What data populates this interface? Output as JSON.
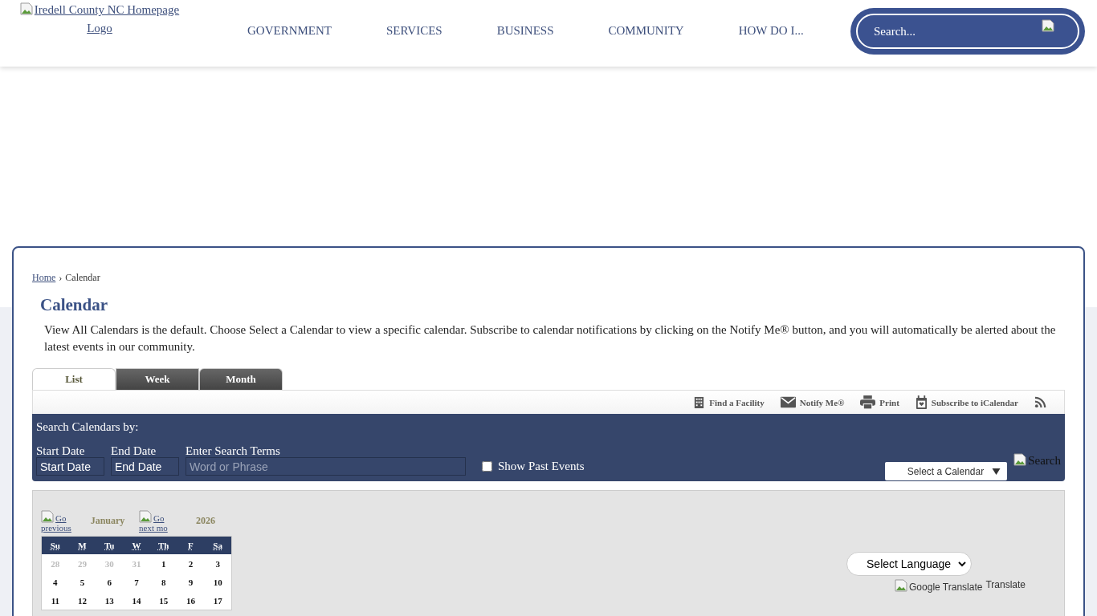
{
  "header": {
    "logo_alt": "Iredell County NC Homepage Logo",
    "nav": [
      {
        "label": "GOVERNMENT"
      },
      {
        "label": "SERVICES"
      },
      {
        "label": "BUSINESS"
      },
      {
        "label": "COMMUNITY"
      },
      {
        "label": "HOW DO I..."
      }
    ],
    "search": {
      "placeholder": "Search..."
    }
  },
  "breadcrumb": {
    "items": [
      {
        "label": "Home",
        "link": true
      },
      {
        "label": "Calendar",
        "link": false
      }
    ],
    "separator": "›"
  },
  "title": "Calendar",
  "intro": "View All Calendars is the default. Choose Select a Calendar to view a specific calendar. Subscribe to calendar notifications by clicking on the Notify Me® button, and you will automatically be alerted about the latest events in our community.",
  "tabs": [
    {
      "label": "List",
      "selected": true
    },
    {
      "label": "Week",
      "selected": false
    },
    {
      "label": "Month",
      "selected": false
    }
  ],
  "toolbar": [
    {
      "kind": "facility",
      "label": "Find a Facility"
    },
    {
      "kind": "notify",
      "label": "Notify Me®"
    },
    {
      "kind": "print",
      "label": "Print"
    },
    {
      "kind": "ical",
      "label": "Subscribe to iCalendar"
    },
    {
      "kind": "rss"
    }
  ],
  "search_panel": {
    "heading": "Search Calendars by:",
    "start_label": "Start Date",
    "start_placeholder": "Start Date",
    "end_label": "End Date",
    "end_placeholder": "End Date",
    "terms_label": "Enter Search Terms",
    "terms_placeholder": "Word or Phrase",
    "past_events": {
      "label": "Show Past Events",
      "checked": false
    },
    "calendar_select": "Select a Calendar",
    "search_alt": "Search"
  },
  "mini_calendar": {
    "prev_link": "Go previous",
    "month": "January",
    "next_link": "Go next mo",
    "year": "2026",
    "weekdays": [
      "Su",
      "M",
      "Tu",
      "W",
      "Th",
      "F",
      "Sa"
    ],
    "weeks": [
      [
        {
          "day": "28",
          "muted": true
        },
        {
          "day": "29",
          "muted": true
        },
        {
          "day": "30",
          "muted": true
        },
        {
          "day": "31",
          "muted": true
        },
        {
          "day": "1",
          "muted": false
        },
        {
          "day": "2",
          "muted": false
        },
        {
          "day": "3",
          "muted": false
        }
      ],
      [
        {
          "day": "4",
          "muted": false
        },
        {
          "day": "5",
          "muted": false
        },
        {
          "day": "6",
          "muted": false
        },
        {
          "day": "7",
          "muted": false
        },
        {
          "day": "8",
          "muted": false
        },
        {
          "day": "9",
          "muted": false
        },
        {
          "day": "10",
          "muted": false
        }
      ],
      [
        {
          "day": "11",
          "muted": false
        },
        {
          "day": "12",
          "muted": false
        },
        {
          "day": "13",
          "muted": false
        },
        {
          "day": "14",
          "muted": false
        },
        {
          "day": "15",
          "muted": false
        },
        {
          "day": "16",
          "muted": false
        },
        {
          "day": "17",
          "muted": false
        }
      ]
    ]
  },
  "language": {
    "select": "Select Language",
    "translate_alt": "Google Translate",
    "translate_link": "Translate"
  }
}
